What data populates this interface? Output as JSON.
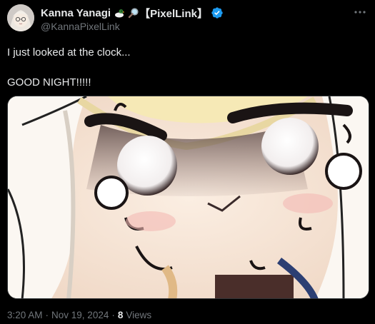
{
  "author": {
    "display_name": "Kanna Yanagi",
    "tag": "【PixelLink】",
    "handle": "@KannaPixelLink",
    "verified": true,
    "emoji_icons": [
      "duck-icon",
      "magnifier-icon"
    ]
  },
  "tweet": {
    "line1": "I just looked at the clock...",
    "line2": "GOOD NIGHT!!!!!"
  },
  "meta": {
    "time": "3:20 AM",
    "separator1": "·",
    "date": "Nov 19, 2024",
    "separator2": "·",
    "views_count": "8",
    "views_label": "Views"
  },
  "colors": {
    "background": "#000000",
    "text": "#e7e9ea",
    "secondary_text": "#71767b",
    "verified_blue": "#1d9bf0"
  }
}
